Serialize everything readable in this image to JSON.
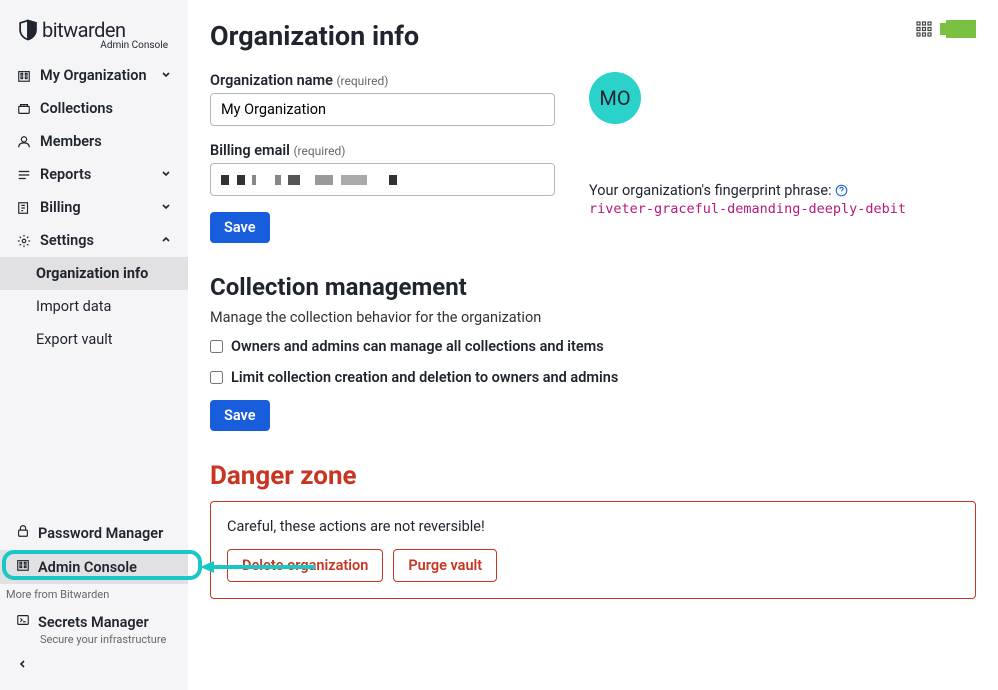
{
  "brand": {
    "name": "bitwarden",
    "subtitle": "Admin Console"
  },
  "sidebar": {
    "items": [
      {
        "label": "My Organization",
        "expandable": true,
        "expanded": false
      },
      {
        "label": "Collections"
      },
      {
        "label": "Members"
      },
      {
        "label": "Reports",
        "expandable": true,
        "expanded": false
      },
      {
        "label": "Billing",
        "expandable": true,
        "expanded": false
      },
      {
        "label": "Settings",
        "expandable": true,
        "expanded": true,
        "children": [
          {
            "label": "Organization info",
            "active": true
          },
          {
            "label": "Import data"
          },
          {
            "label": "Export vault"
          }
        ]
      }
    ]
  },
  "switcher": {
    "password_manager": "Password Manager",
    "admin_console": "Admin Console",
    "more_label": "More from Bitwarden",
    "secrets_manager": "Secrets Manager",
    "secrets_sub": "Secure your infrastructure"
  },
  "page": {
    "title": "Organization info",
    "org_name_label": "Organization name",
    "required": "(required)",
    "org_name_value": "My Organization",
    "billing_label": "Billing email",
    "save": "Save",
    "avatar_initials": "MO",
    "fingerprint_label": "Your organization's fingerprint phrase:",
    "fingerprint_value": "riveter-graceful-demanding-deeply-debit"
  },
  "collection": {
    "title": "Collection management",
    "subtitle": "Manage the collection behavior for the organization",
    "opt1": "Owners and admins can manage all collections and items",
    "opt2": "Limit collection creation and deletion to owners and admins",
    "save": "Save"
  },
  "danger": {
    "title": "Danger zone",
    "warning": "Careful, these actions are not reversible!",
    "delete": "Delete organization",
    "purge": "Purge vault"
  }
}
